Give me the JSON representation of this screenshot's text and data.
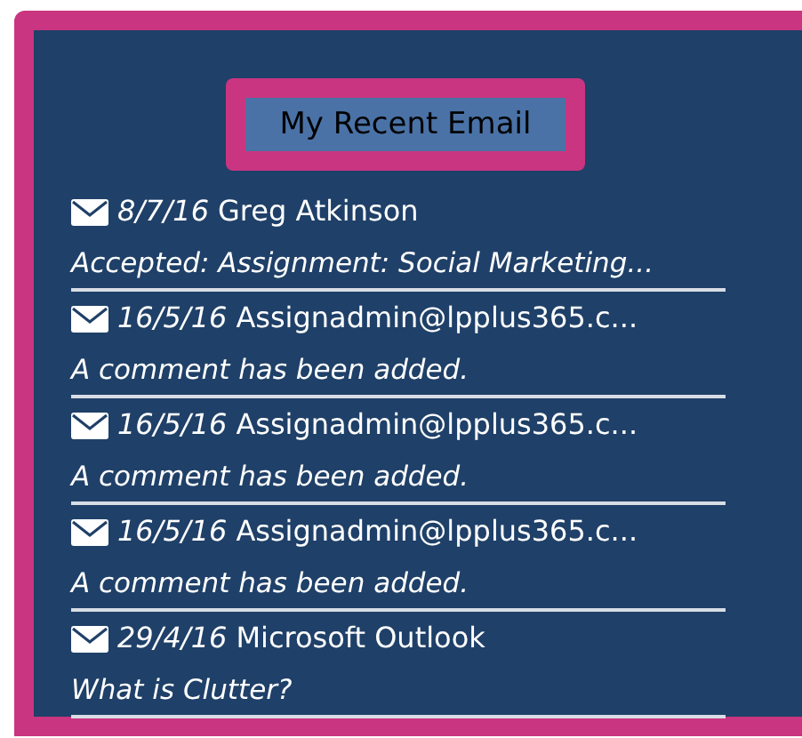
{
  "title": "My Recent Email",
  "emails": [
    {
      "date": "8/7/16",
      "sender": "Greg Atkinson",
      "subject": "Accepted: Assignment: Social Marketing..."
    },
    {
      "date": "16/5/16",
      "sender": "Assignadmin@lpplus365.c...",
      "subject": "A comment has been added."
    },
    {
      "date": "16/5/16",
      "sender": "Assignadmin@lpplus365.c...",
      "subject": "A comment has been added."
    },
    {
      "date": "16/5/16",
      "sender": "Assignadmin@lpplus365.c...",
      "subject": "A comment has been added."
    },
    {
      "date": "29/4/16",
      "sender": "Microsoft Outlook",
      "subject": "What is Clutter?"
    }
  ]
}
